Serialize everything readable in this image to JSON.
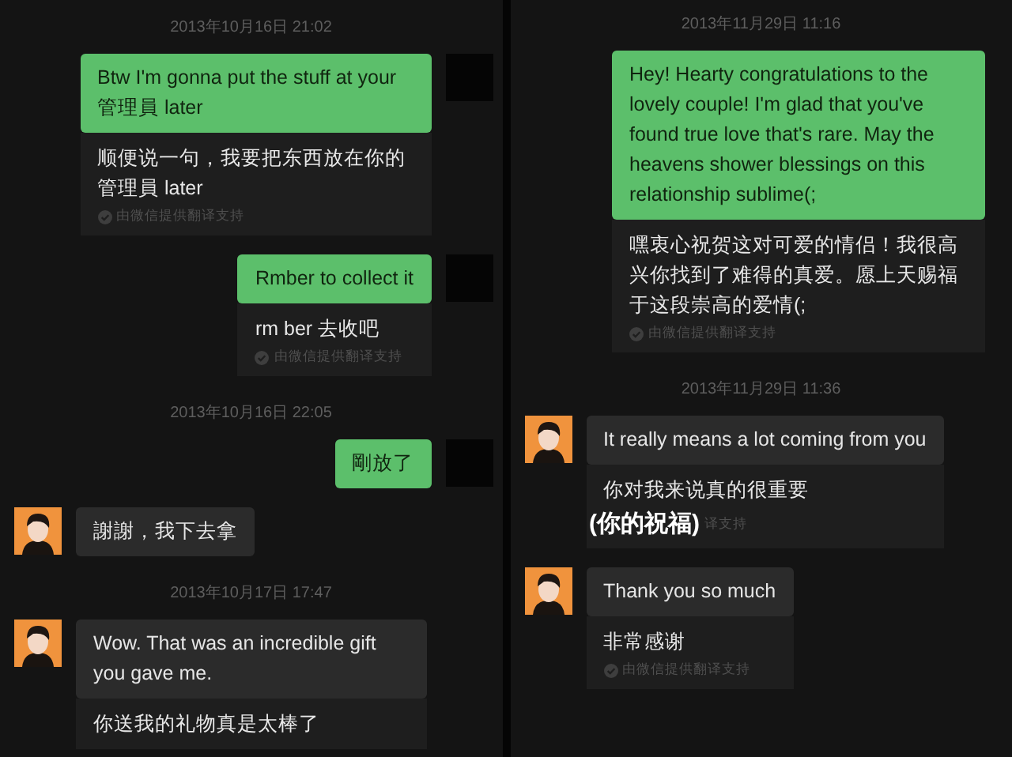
{
  "panels": [
    {
      "items": [
        {
          "kind": "time",
          "text": "2013年10月16日 21:02"
        },
        {
          "kind": "sent",
          "avatar": true,
          "text": "Btw I'm gonna put the stuff at your 管理員 later",
          "translation": {
            "text": "顺便说一句，我要把东西放在你的管理員 later",
            "note": "由微信提供翻译支持"
          }
        },
        {
          "kind": "sent",
          "avatar": true,
          "text": "Rmber to collect it",
          "translation": {
            "text": "rm ber 去收吧",
            "note": "由微信提供翻译支持"
          }
        },
        {
          "kind": "time",
          "text": "2013年10月16日 22:05"
        },
        {
          "kind": "sent",
          "avatar": true,
          "text": "剛放了"
        },
        {
          "kind": "received",
          "avatar": true,
          "text": "謝謝，我下去拿"
        },
        {
          "kind": "time",
          "text": "2013年10月17日 17:47"
        },
        {
          "kind": "received",
          "avatar": true,
          "text": "Wow.  That was an incredible gift you gave me.",
          "translation": {
            "text": "你送我的礼物真是太棒了"
          }
        }
      ]
    },
    {
      "items": [
        {
          "kind": "time",
          "text": "2013年11月29日 11:16"
        },
        {
          "kind": "sent",
          "avatar": false,
          "text": "Hey! Hearty congratulations to the lovely couple! I'm glad that you've found true love that's rare. May the heavens shower blessings on this relationship sublime(;",
          "translation": {
            "text": "嘿衷心祝贺这对可爱的情侣！我很高兴你找到了难得的真爱。愿上天赐福于这段崇高的爱情(;",
            "note": "由微信提供翻译支持"
          }
        },
        {
          "kind": "time",
          "text": "2013年11月29日 11:36"
        },
        {
          "kind": "received",
          "avatar": true,
          "text": "It really means a lot coming from you",
          "translation": {
            "text": "你对我来说真的很重要",
            "overlay": "(你的祝福)",
            "note": "译支持"
          }
        },
        {
          "kind": "received",
          "avatar": true,
          "text": "Thank you so much",
          "translation": {
            "text": "非常感谢",
            "note": "由微信提供翻译支持"
          }
        }
      ]
    }
  ]
}
